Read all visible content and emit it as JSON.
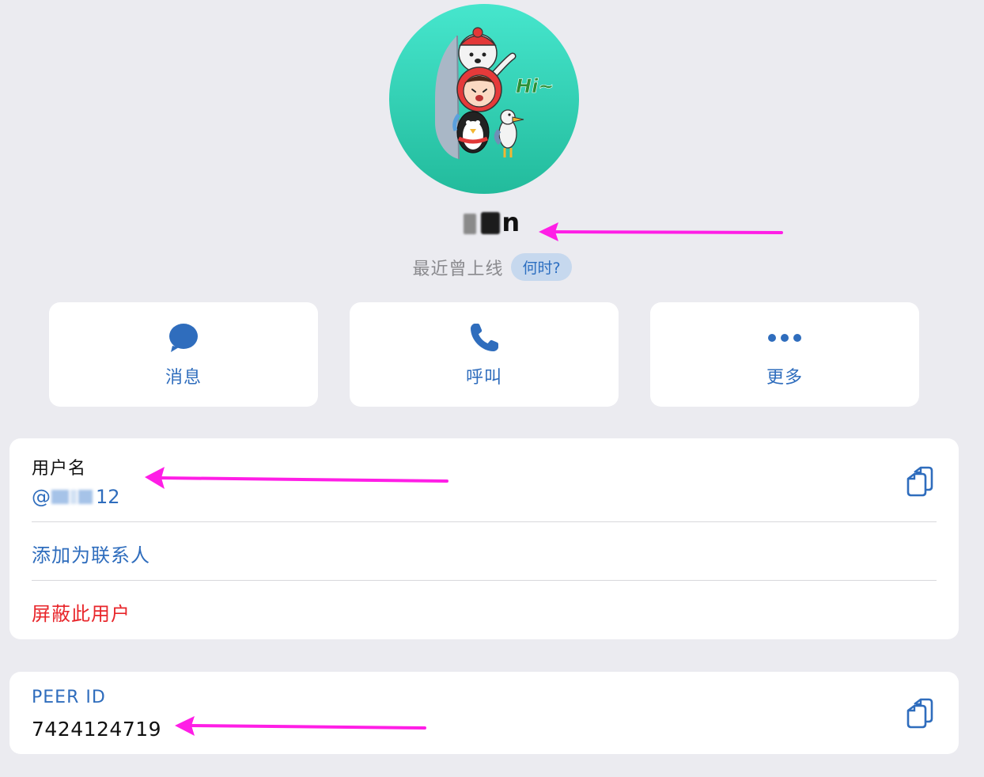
{
  "profile": {
    "name_suffix": "n",
    "status": "最近曾上线",
    "status_pill": "何时?"
  },
  "avatar": {
    "sticker_text": "Hi~"
  },
  "actions": [
    {
      "label": "消息",
      "icon": "chat-bubble-icon"
    },
    {
      "label": "呼叫",
      "icon": "phone-icon"
    },
    {
      "label": "更多",
      "icon": "more-dots-icon"
    }
  ],
  "info": {
    "username_label": "用户名",
    "username_prefix": "@",
    "username_suffix": "12",
    "add_contact": "添加为联系人",
    "block_user": "屏蔽此用户"
  },
  "peer": {
    "label": "PEER ID",
    "value": "7424124719"
  },
  "colors": {
    "accent": "#2f6dbd",
    "danger": "#e8262b",
    "annotation": "#ff1ee6",
    "background": "#ebebf0"
  }
}
